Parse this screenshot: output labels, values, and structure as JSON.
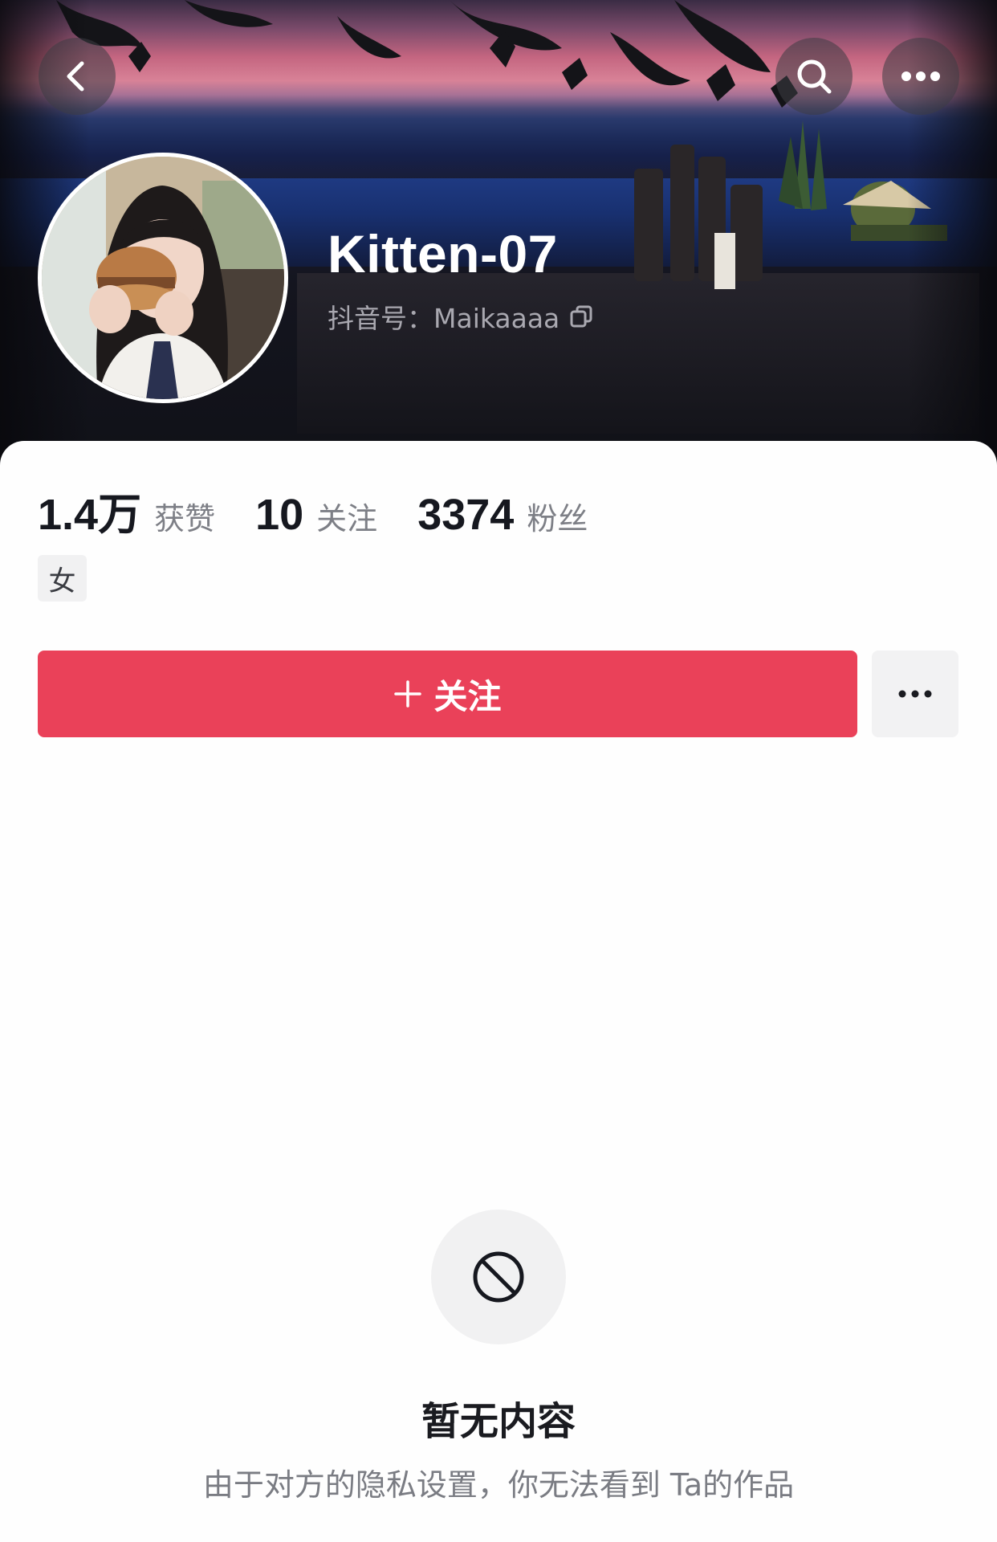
{
  "header": {
    "back_icon": "chevron-left-icon",
    "search_icon": "search-icon",
    "more_icon": "more-horizontal-icon"
  },
  "profile": {
    "nickname": "Kitten-07",
    "douyin_id": "抖音号：Maikaaaa",
    "copy_icon": "copy-icon"
  },
  "stats": [
    {
      "value": "1.4万",
      "label": "获赞"
    },
    {
      "value": "10",
      "label": "关注"
    },
    {
      "value": "3374",
      "label": "粉丝"
    }
  ],
  "tags": [
    "女"
  ],
  "actions": {
    "follow_label": "关注",
    "follow_icon": "plus-icon",
    "more_icon": "more-horizontal-icon"
  },
  "empty_state": {
    "icon": "no-entry-icon",
    "title": "暂无内容",
    "description": "由于对方的隐私设置，你无法看到 Ta的作品"
  },
  "colors": {
    "accent": "#ea4159",
    "card_background": "#fefefe",
    "muted_text": "#7d7f86"
  }
}
